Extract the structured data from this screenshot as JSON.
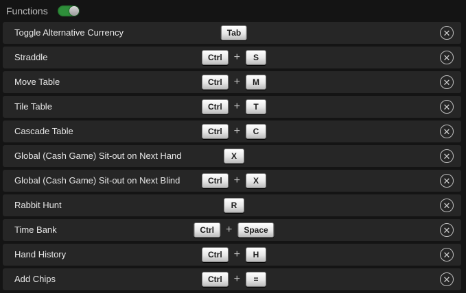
{
  "header": {
    "title": "Functions",
    "toggle_on": true,
    "toggle_color": "#2e8f3a"
  },
  "remove_symbol": "✕",
  "plus_symbol": "+",
  "rows": [
    {
      "label": "Toggle Alternative Currency",
      "keys": [
        "Tab"
      ]
    },
    {
      "label": "Straddle",
      "keys": [
        "Ctrl",
        "S"
      ]
    },
    {
      "label": "Move Table",
      "keys": [
        "Ctrl",
        "M"
      ]
    },
    {
      "label": "Tile Table",
      "keys": [
        "Ctrl",
        "T"
      ]
    },
    {
      "label": "Cascade Table",
      "keys": [
        "Ctrl",
        "C"
      ]
    },
    {
      "label": "Global (Cash Game) Sit-out on Next Hand",
      "keys": [
        "X"
      ]
    },
    {
      "label": "Global (Cash Game) Sit-out on Next Blind",
      "keys": [
        "Ctrl",
        "X"
      ]
    },
    {
      "label": "Rabbit Hunt",
      "keys": [
        "R"
      ]
    },
    {
      "label": "Time Bank",
      "keys": [
        "Ctrl",
        "Space"
      ]
    },
    {
      "label": "Hand History",
      "keys": [
        "Ctrl",
        "H"
      ]
    },
    {
      "label": "Add Chips",
      "keys": [
        "Ctrl",
        "="
      ]
    }
  ]
}
